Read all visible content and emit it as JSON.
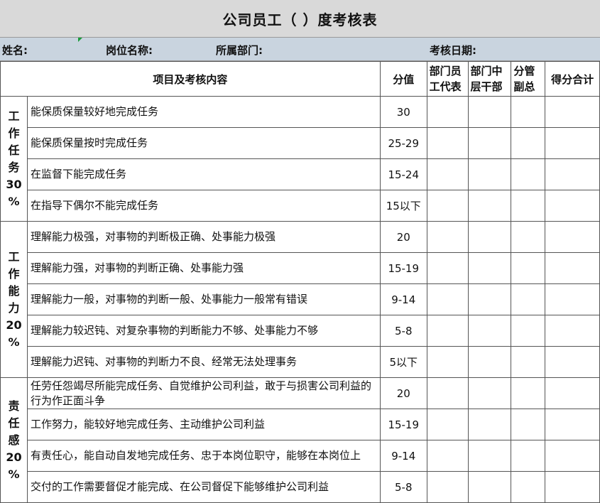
{
  "title": "公司员工（      ）度考核表",
  "info": {
    "name_label": "姓名:",
    "position_label": "岗位名称:",
    "dept_label": "所属部门:",
    "date_label": "考核日期:"
  },
  "headers": {
    "item": "项目及考核内容",
    "score": "分值",
    "rater1": "部门员\n工代表",
    "rater2": "部门中\n层干部",
    "rater3": "分管\n副总",
    "total": "得分合计"
  },
  "categories": [
    {
      "chars": [
        "工",
        "作",
        "任",
        "务",
        "30",
        "%"
      ],
      "rows": [
        {
          "text": "能保质保量较好地完成任务",
          "score": "30"
        },
        {
          "text": "能保质保量按时完成任务",
          "score": "25-29"
        },
        {
          "text": "在监督下能完成任务",
          "score": "15-24"
        },
        {
          "text": "在指导下偶尔不能完成任务",
          "score": "15以下"
        }
      ]
    },
    {
      "chars": [
        "工",
        "作",
        "能",
        "力",
        "20",
        "%"
      ],
      "rows": [
        {
          "text": "理解能力极强，对事物的判断极正确、处事能力极强",
          "score": "20"
        },
        {
          "text": "理解能力强，对事物的判断正确、处事能力强",
          "score": "15-19"
        },
        {
          "text": "理解能力一般，对事物的判断一般、处事能力一般常有错误",
          "score": "9-14"
        },
        {
          "text": "理解能力较迟钝、对复杂事物的判断能力不够、处事能力不够",
          "score": "5-8"
        },
        {
          "text": "理解能力迟钝、对事物的判断力不良、经常无法处理事务",
          "score": "5以下"
        }
      ]
    },
    {
      "chars": [
        "责",
        "任",
        "感",
        "20",
        "%"
      ],
      "rows": [
        {
          "text": "任劳任怨竭尽所能完成任务、自觉维护公司利益，敢于与损害公司利益的行为作正面斗争",
          "score": "20"
        },
        {
          "text": "工作努力，能较好地完成任务、主动维护公司利益",
          "score": "15-19"
        },
        {
          "text": "有责任心，能自动自发地完成任务、忠于本岗位职守，能够在本岗位上",
          "score": "9-14"
        },
        {
          "text": "交付的工作需要督促才能完成、在公司督促下能够维护公司利益",
          "score": "5-8"
        }
      ]
    }
  ]
}
